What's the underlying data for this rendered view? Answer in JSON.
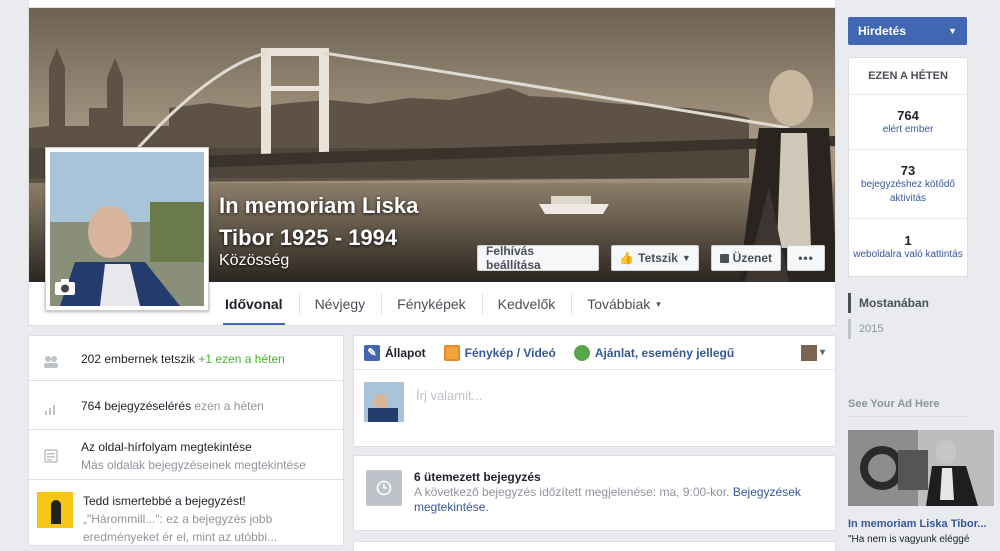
{
  "cover": {
    "page_title": "In memoriam Liska Tibor 1925 - 1994",
    "category": "Közösség",
    "cta_button": "Felhívás beállítása",
    "like_button": "Tetszik",
    "message_button": "Üzenet",
    "more_button": "•••"
  },
  "tabs": [
    "Idővonal",
    "Névjegy",
    "Fényképek",
    "Kedvelők",
    "Továbbiak"
  ],
  "tabs_more_caret": "▾",
  "left": {
    "likes_count": "202 embernek tetszik",
    "likes_delta": "+1 ezen a héten",
    "reach_count": "764 bejegyzéselérés",
    "reach_period": "ezen a héten",
    "feed_title": "Az oldal-hírfolyam megtekintése",
    "feed_sub": "Más oldalak bejegyzéseinek megtekintése",
    "promo_title": "Tedd ismertebbé a bejegyzést!",
    "promo_text_1": "„\"Hárommill...\": ez a bejegyzés jobb",
    "promo_text_2": "eredményeket ér el, mint az utóbbi..."
  },
  "composer": {
    "tab_status": "Állapot",
    "tab_photo": "Fénykép / Videó",
    "tab_offer": "Ajánlat, esemény jellegű",
    "placeholder": "Írj valamit...",
    "caret": "▾"
  },
  "scheduled": {
    "title": "6 ütemezett bejegyzés",
    "text": "A következő bejegyzés időzített megjelenése: ma, 9:00-kor.",
    "link_1": "Bejegyzések",
    "link_2": "megtekintése."
  },
  "right": {
    "ad_button": "Hirdetés",
    "ad_caret": "▼",
    "week_heading": "EZEN A HÉTEN",
    "stats": [
      {
        "num": "764",
        "label": "elért ember"
      },
      {
        "num": "73",
        "label": "bejegyzéshez kötődő aktivitás"
      },
      {
        "num": "1",
        "label": "weboldalra való kattintás"
      }
    ],
    "timeline_nav": [
      "Mostanában",
      "2015"
    ],
    "see_ad": "See Your Ad Here",
    "ad_title": "In memoriam Liska Tibor...",
    "ad_text": "\"Ha nem is vagyunk eléggé"
  },
  "colors": {
    "accent": "#4267b2",
    "link": "#365899",
    "green": "#42b72a"
  },
  "icons": [
    "camera-icon",
    "thumbs-up-icon",
    "message-icon",
    "people-icon",
    "bar-chart-icon",
    "news-feed-icon",
    "pencil-icon",
    "photo-icon",
    "offer-icon",
    "clock-icon"
  ]
}
